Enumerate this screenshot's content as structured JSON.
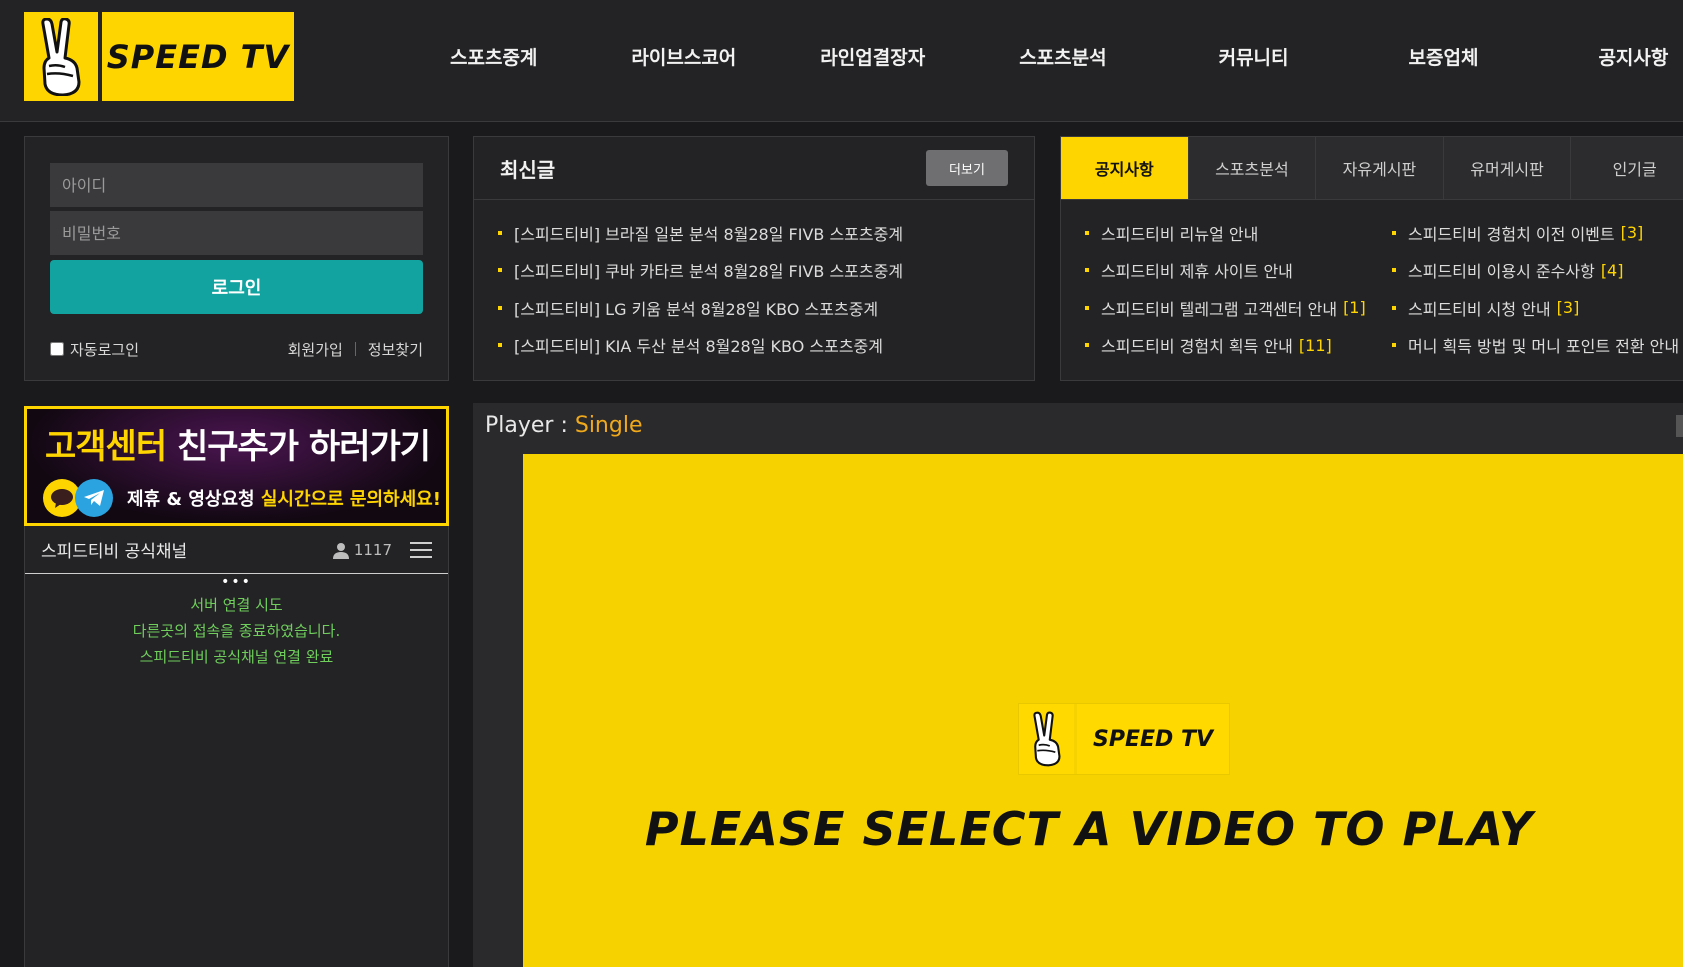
{
  "brand": {
    "name": "SPEED TV",
    "color": "#ffd500"
  },
  "nav": [
    "스포츠중계",
    "라이브스코어",
    "라인업결장자",
    "스포츠분석",
    "커뮤니티",
    "보증업체",
    "공지사항"
  ],
  "login": {
    "id_placeholder": "아이디",
    "pw_placeholder": "비밀번호",
    "login_label": "로그인",
    "auto_login": "자동로그인",
    "signup": "회원가입",
    "find_info": "정보찾기",
    "button_color": "#12a3a0"
  },
  "latest": {
    "title": "최신글",
    "more": "더보기",
    "posts": [
      "[스피드티비] 브라질 일본 분석 8월28일 FIVB 스포츠중계",
      "[스피드티비] 쿠바 카타르 분석 8월28일 FIVB 스포츠중계",
      "[스피드티비] LG 키움 분석 8월28일 KBO 스포츠중계",
      "[스피드티비] KIA 두산 분석 8월28일 KBO 스포츠중계"
    ]
  },
  "notice": {
    "tabs": [
      "공지사항",
      "스포츠분석",
      "자유게시판",
      "유머게시판",
      "인기글"
    ],
    "left": [
      {
        "title": "스피드티비 리뉴얼 안내",
        "count": ""
      },
      {
        "title": "스피드티비 제휴 사이트 안내",
        "count": ""
      },
      {
        "title": "스피드티비 텔레그램 고객센터 안내",
        "count": "[1]"
      },
      {
        "title": "스피드티비 경험치 획득 안내",
        "count": "[11]"
      }
    ],
    "right": [
      {
        "title": "스피드티비 경험치 이전 이벤트",
        "count": "[3]"
      },
      {
        "title": "스피드티비 이용시 준수사항",
        "count": "[4]"
      },
      {
        "title": "스피드티비 시청 안내",
        "count": "[3]"
      },
      {
        "title": "머니 획득 방법 및 머니 포인트 전환 안내",
        "count": ""
      }
    ]
  },
  "banner": {
    "main_hl": "고객센터",
    "main_rest": " 친구추가 하러가기",
    "sub_text": "제휴 & 영상요청 ",
    "sub_hl": "실시간으로 문의하세요!",
    "icons": [
      "kakao-talk-icon",
      "telegram-icon"
    ]
  },
  "chat": {
    "title": "스피드티비 공식채널",
    "user_count": "1117",
    "messages": [
      "서버 연결 시도",
      "다른곳의 접속을 종료하였습니다.",
      "스피드티비 공식채널 연결 완료"
    ],
    "message_color": "#6fce5c"
  },
  "player": {
    "label": "Player : ",
    "mode": "Single",
    "logo_text": "SPEED TV",
    "message": "PLEASE SELECT A VIDEO TO PLAY"
  }
}
